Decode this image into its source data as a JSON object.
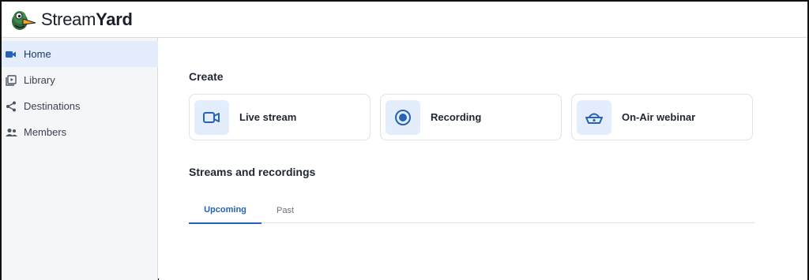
{
  "brand": {
    "name_light": "Stream",
    "name_bold": "Yard"
  },
  "sidebar": {
    "items": [
      {
        "label": "Home",
        "icon": "video-camera-icon",
        "active": true
      },
      {
        "label": "Library",
        "icon": "library-icon",
        "active": false
      },
      {
        "label": "Destinations",
        "icon": "share-icon",
        "active": false
      },
      {
        "label": "Members",
        "icon": "members-icon",
        "active": false
      }
    ]
  },
  "main": {
    "create_title": "Create",
    "create_cards": [
      {
        "label": "Live stream",
        "icon": "video-camera-icon"
      },
      {
        "label": "Recording",
        "icon": "record-icon"
      },
      {
        "label": "On-Air webinar",
        "icon": "webinar-icon"
      }
    ],
    "streams_title": "Streams and recordings",
    "tabs": [
      {
        "label": "Upcoming",
        "active": true
      },
      {
        "label": "Past",
        "active": false
      }
    ]
  },
  "colors": {
    "accent": "#2563b8",
    "active_bg": "#e3edfb",
    "sidebar_bg": "#f5f6f8"
  }
}
